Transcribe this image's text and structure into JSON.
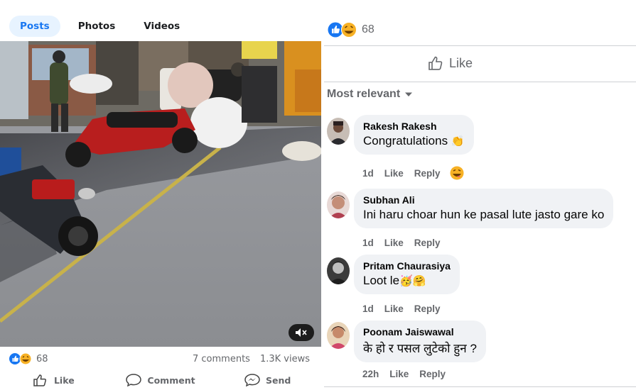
{
  "tabs": [
    {
      "label": "Posts",
      "active": true
    },
    {
      "label": "Photos",
      "active": false
    },
    {
      "label": "Videos",
      "active": false
    }
  ],
  "post": {
    "reaction_count": "68",
    "comments_count": "7 comments",
    "views": "1.3K views",
    "actions": {
      "like": "Like",
      "comment": "Comment",
      "send": "Send"
    },
    "video_icons": {
      "mute": "mute-icon"
    }
  },
  "comments_panel": {
    "reaction_count": "68",
    "like_label": "Like",
    "sort_label": "Most relevant",
    "comments": [
      {
        "name": "Rakesh Rakesh",
        "text": "Congratulations",
        "emoji": "👏",
        "time": "1d",
        "like": "Like",
        "reply": "Reply"
      },
      {
        "name": "Subhan Ali",
        "text": "Ini haru choar hun ke pasal lute jasto gare ko",
        "time": "1d",
        "like": "Like",
        "reply": "Reply"
      },
      {
        "name": "Pritam Chaurasiya",
        "text": "Loot le",
        "emoji": "🥳🤗",
        "time": "1d",
        "like": "Like",
        "reply": "Reply"
      },
      {
        "name": "Poonam Jaiswawal",
        "text": "के हो र पसल लुटेको हुन ?",
        "time": "22h",
        "like": "Like",
        "reply": "Reply"
      }
    ]
  },
  "colors": {
    "facebook_blue": "#1877f2",
    "reaction_haha": "#f7b125",
    "muted_text": "#65676b",
    "bubble_bg": "#f0f2f5"
  }
}
